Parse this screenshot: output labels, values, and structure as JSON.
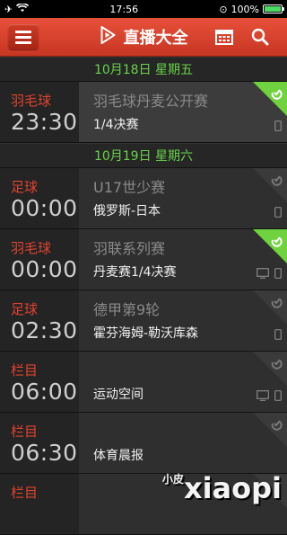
{
  "status_bar": {
    "time": "17:56",
    "battery": "100%"
  },
  "header": {
    "title": "直播大全"
  },
  "sections": [
    {
      "date": "10月18日 星期五",
      "items": [
        {
          "category": "羽毛球",
          "time": "23:30",
          "name": "羽毛球丹麦公开赛",
          "detail": "1/4决赛",
          "highlight": true,
          "badge": "green",
          "devices": [
            "phone"
          ]
        }
      ]
    },
    {
      "date": "10月19日 星期六",
      "items": [
        {
          "category": "足球",
          "time": "00:00",
          "name": "U17世少赛",
          "detail": "俄罗斯-日本",
          "highlight": false,
          "badge": "gray",
          "devices": [
            "phone"
          ]
        },
        {
          "category": "羽毛球",
          "time": "00:00",
          "name": "羽联系列赛",
          "detail": "丹麦赛1/4决赛",
          "highlight": false,
          "badge": "green",
          "devices": [
            "tv",
            "phone"
          ]
        },
        {
          "category": "足球",
          "time": "02:30",
          "name": "德甲第9轮",
          "detail": "霍芬海姆-勒沃库森",
          "highlight": false,
          "badge": "gray",
          "devices": [
            "phone"
          ]
        },
        {
          "category": "栏目",
          "time": "06:00",
          "name": "",
          "detail": "运动空间",
          "highlight": false,
          "badge": "gray",
          "devices": [
            "tv",
            "phone"
          ]
        },
        {
          "category": "栏目",
          "time": "06:30",
          "name": "",
          "detail": "体育晨报",
          "highlight": false,
          "badge": "gray",
          "devices": [
            "tv",
            "phone"
          ]
        },
        {
          "category": "栏目",
          "time": "",
          "name": "",
          "detail": "",
          "highlight": false,
          "badge": "gray",
          "devices": []
        }
      ]
    }
  ],
  "watermark": {
    "text": "xiaopi",
    "small": "小皮"
  }
}
